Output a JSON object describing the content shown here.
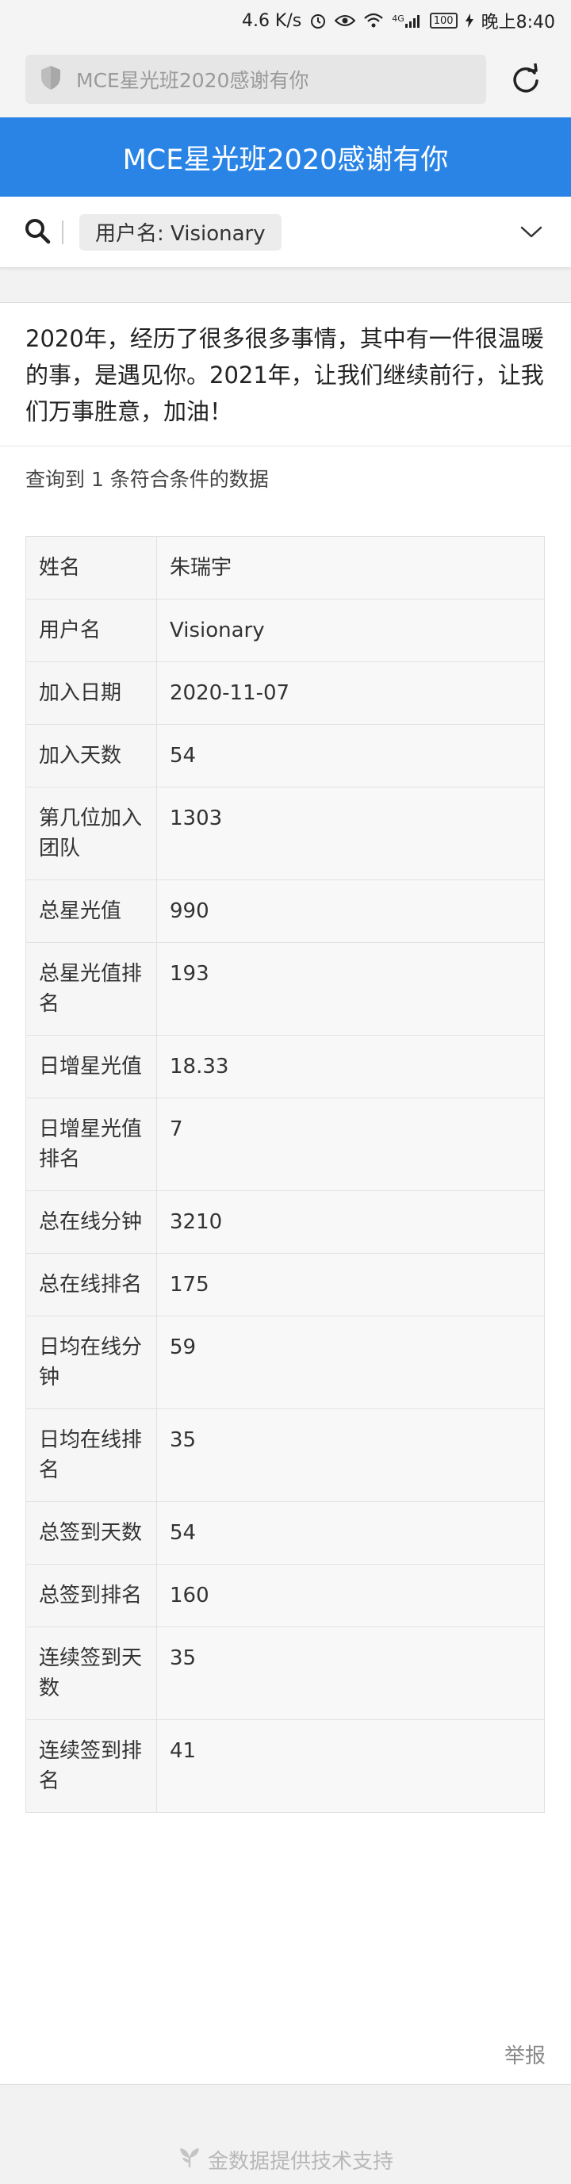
{
  "status_bar": {
    "speed": "4.6 K/s",
    "signal_label": "4G",
    "battery": "100",
    "time": "晚上8:40"
  },
  "browser": {
    "address": "MCE星光班2020感谢有你"
  },
  "header": {
    "title": "MCE星光班2020感谢有你"
  },
  "filter": {
    "tag": "用户名: Visionary"
  },
  "intro": "2020年，经历了很多很多事情，其中有一件很温暖的事，是遇见你。2021年，让我们继续前行，让我们万事胜意，加油！",
  "result_count": "查询到 1 条符合条件的数据",
  "rows": [
    {
      "label": "姓名",
      "value": "朱瑞宇"
    },
    {
      "label": "用户名",
      "value": "Visionary"
    },
    {
      "label": "加入日期",
      "value": "2020-11-07"
    },
    {
      "label": "加入天数",
      "value": "54"
    },
    {
      "label": "第几位加入团队",
      "value": "1303"
    },
    {
      "label": "总星光值",
      "value": "990"
    },
    {
      "label": "总星光值排名",
      "value": "193"
    },
    {
      "label": "日增星光值",
      "value": "18.33"
    },
    {
      "label": "日增星光值排名",
      "value": "7"
    },
    {
      "label": "总在线分钟",
      "value": "3210"
    },
    {
      "label": "总在线排名",
      "value": "175"
    },
    {
      "label": "日均在线分钟",
      "value": "59"
    },
    {
      "label": "日均在线排名",
      "value": "35"
    },
    {
      "label": "总签到天数",
      "value": "54"
    },
    {
      "label": "总签到排名",
      "value": "160"
    },
    {
      "label": "连续签到天数",
      "value": "35"
    },
    {
      "label": "连续签到排名",
      "value": "41"
    }
  ],
  "report_label": "举报",
  "footer": "金数据提供技术支持",
  "colors": {
    "header_blue": "#2a84e6"
  }
}
